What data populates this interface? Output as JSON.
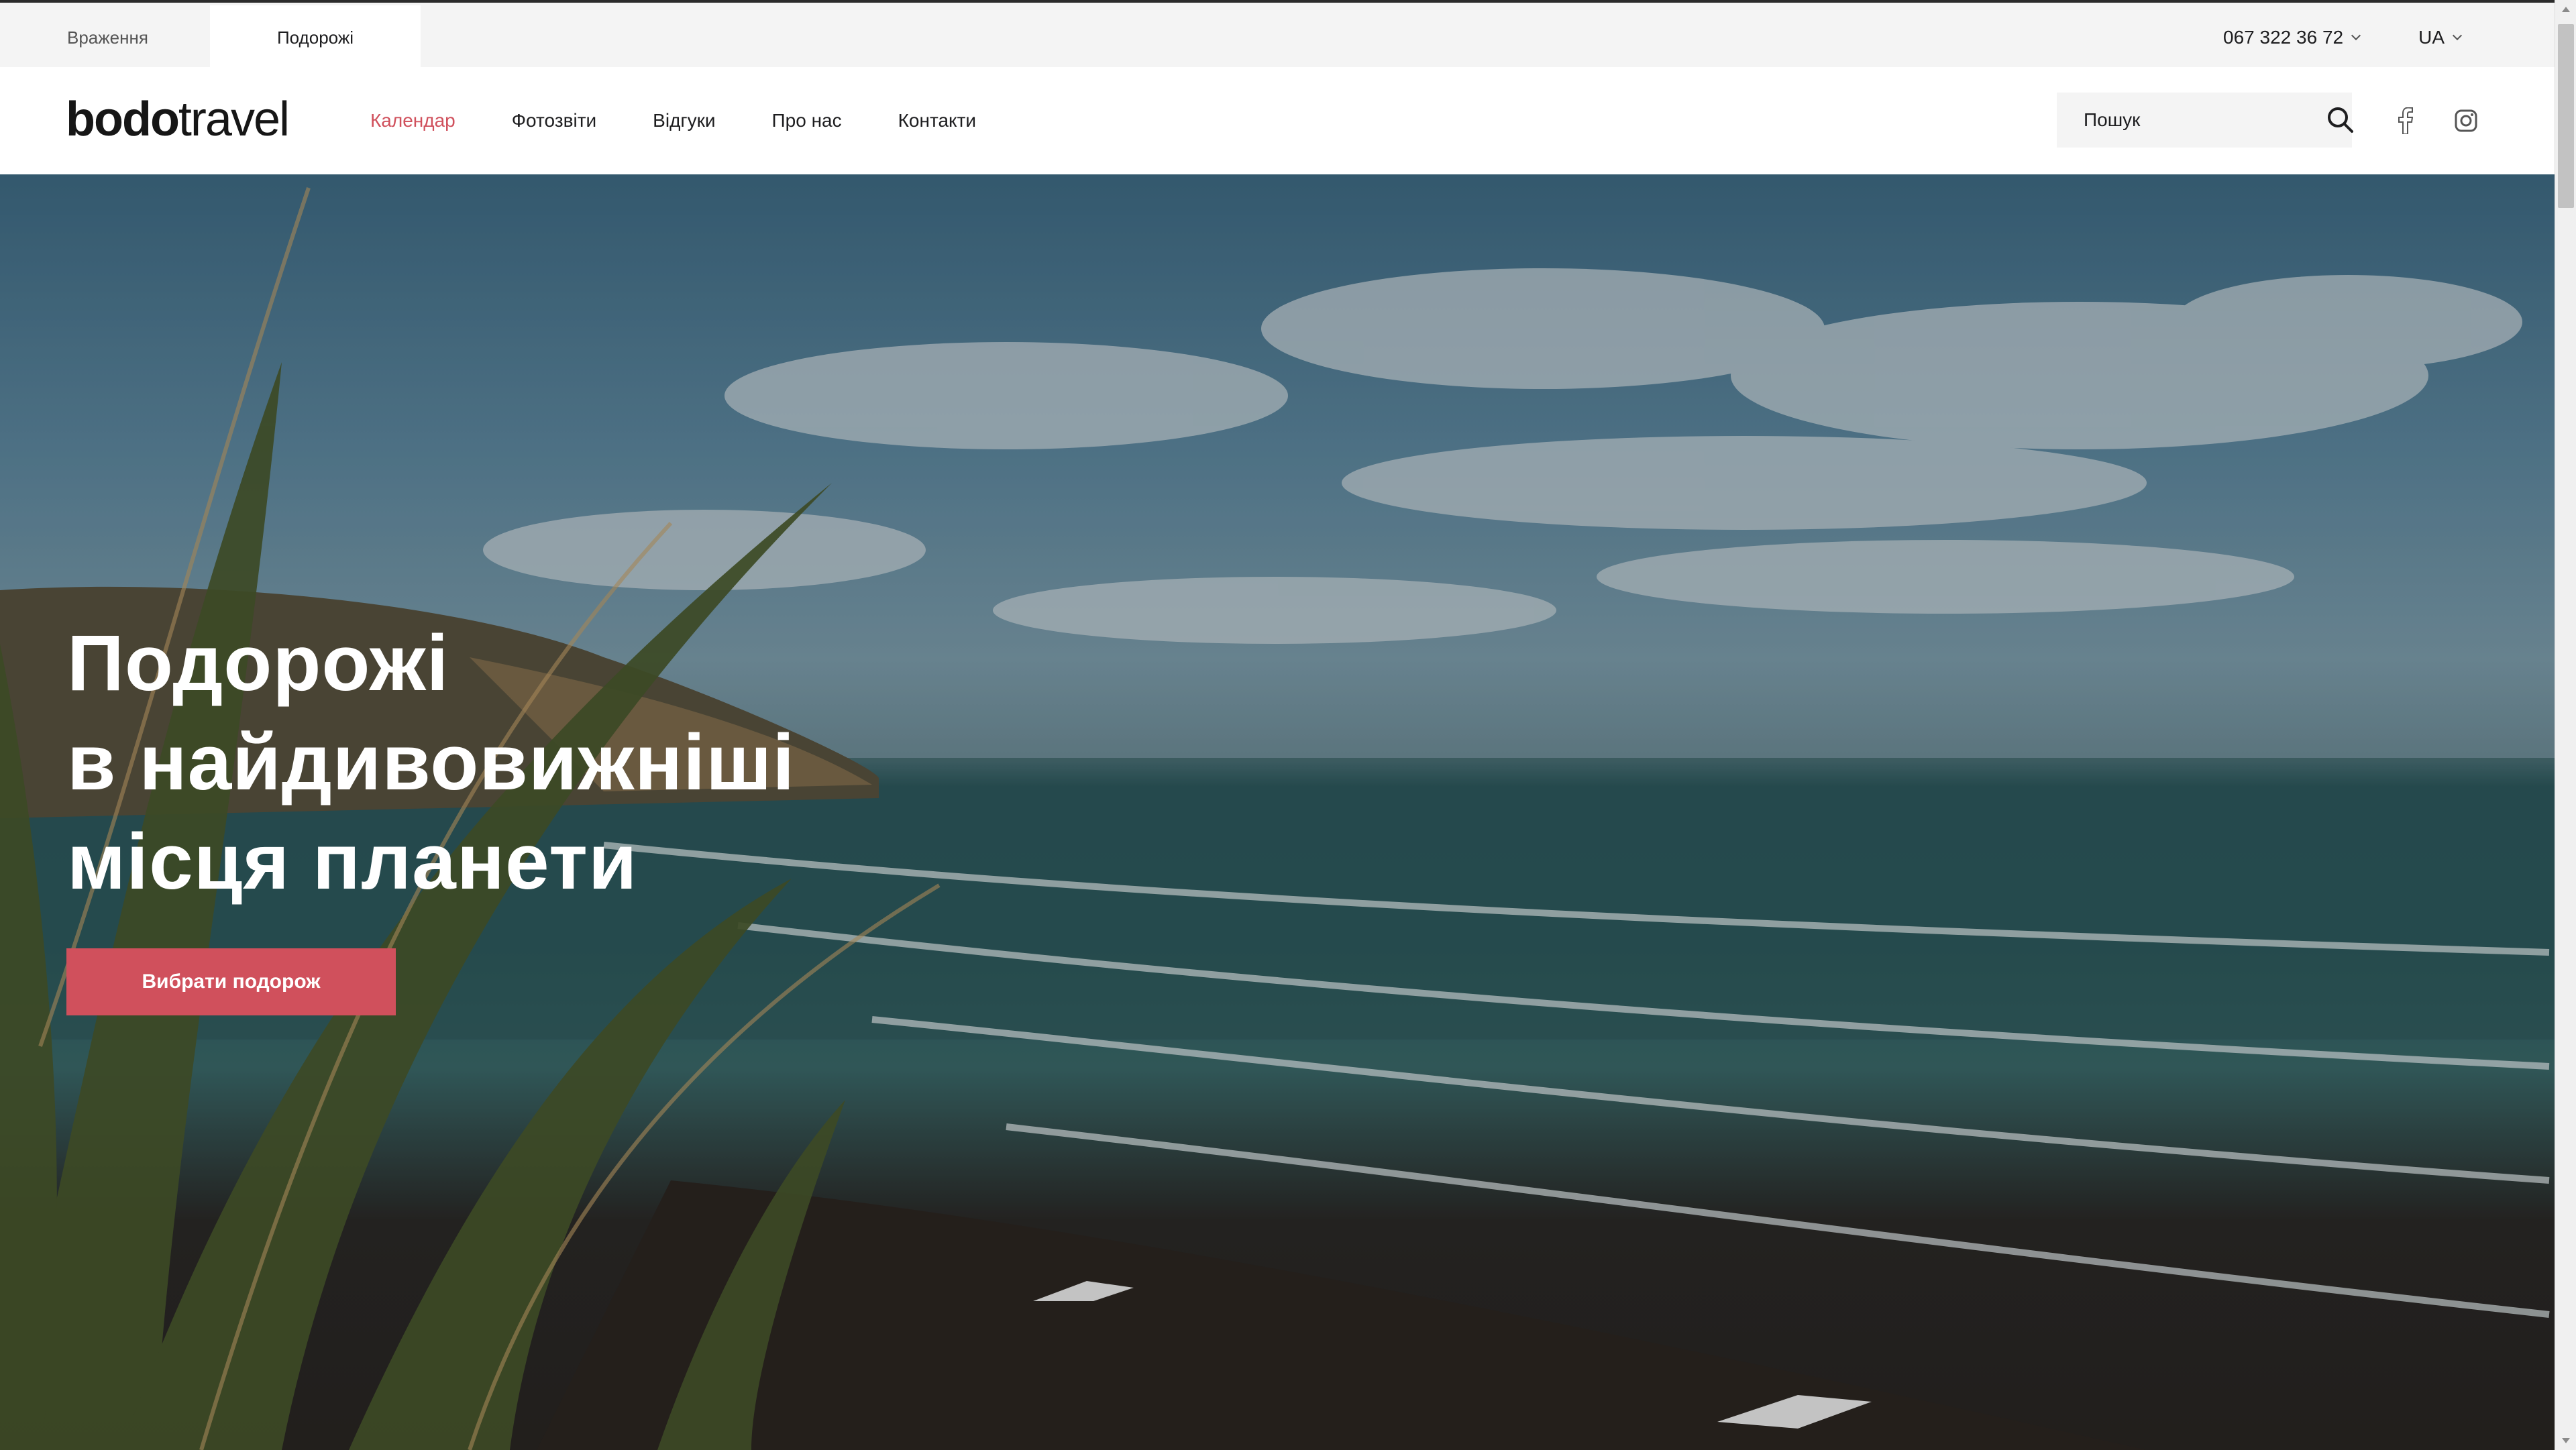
{
  "topbar": {
    "tabs": [
      {
        "label": "Враження",
        "active": false
      },
      {
        "label": "Подорожі",
        "active": true
      }
    ],
    "phone": "067 322 36 72",
    "language": "UA"
  },
  "header": {
    "logo": {
      "bold": "bodo",
      "light": "travel"
    },
    "nav": [
      {
        "label": "Календар",
        "active": true
      },
      {
        "label": "Фотозвіти",
        "active": false
      },
      {
        "label": "Відгуки",
        "active": false
      },
      {
        "label": "Про нас",
        "active": false
      },
      {
        "label": "Контакти",
        "active": false
      }
    ],
    "search": {
      "placeholder": "Пошук",
      "value": ""
    },
    "social": [
      "facebook-icon",
      "instagram-icon"
    ]
  },
  "hero": {
    "title_lines": [
      "Подорожі",
      "в найдивовижніші",
      "місця планети"
    ],
    "cta_label": "Вибрати подорож"
  },
  "colors": {
    "accent": "#d0505c",
    "text": "#1d1d1f",
    "topbar_bg": "#f4f4f4"
  }
}
